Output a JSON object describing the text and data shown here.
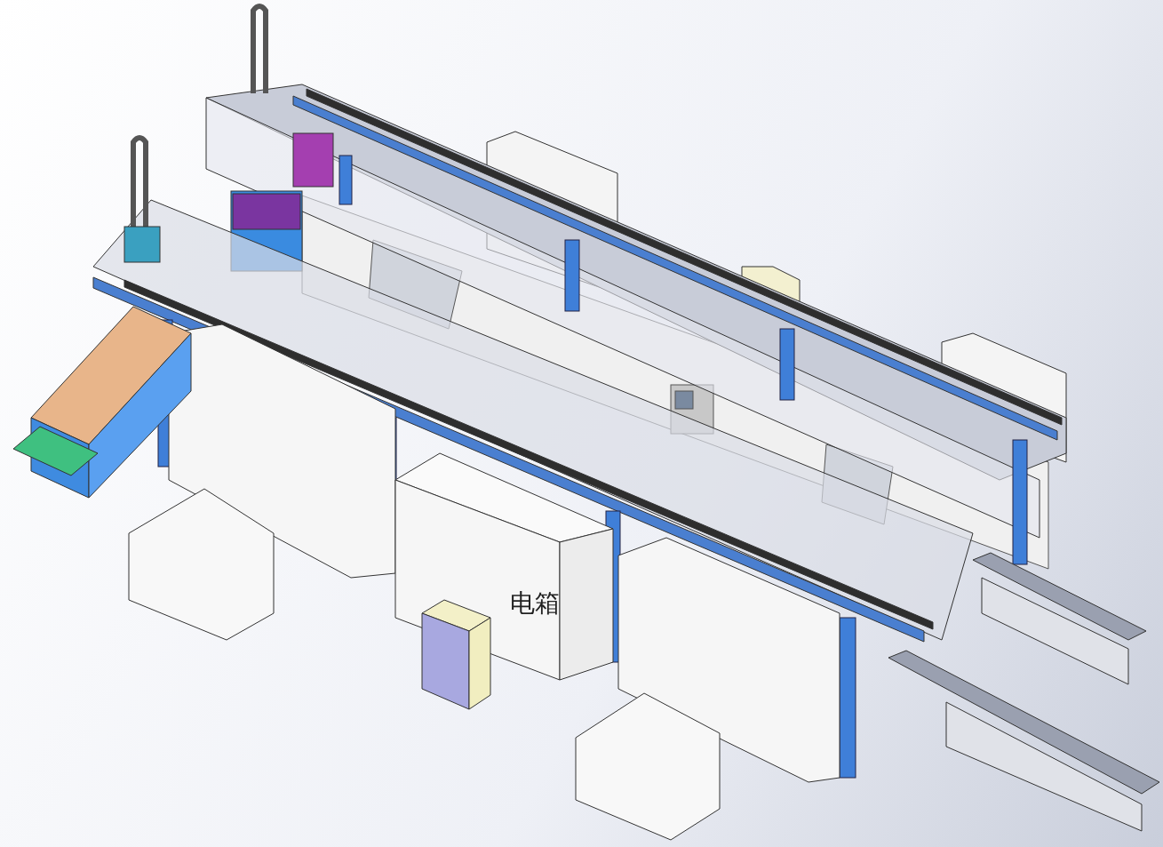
{
  "viewport": {
    "cabinet_label": "电箱"
  }
}
